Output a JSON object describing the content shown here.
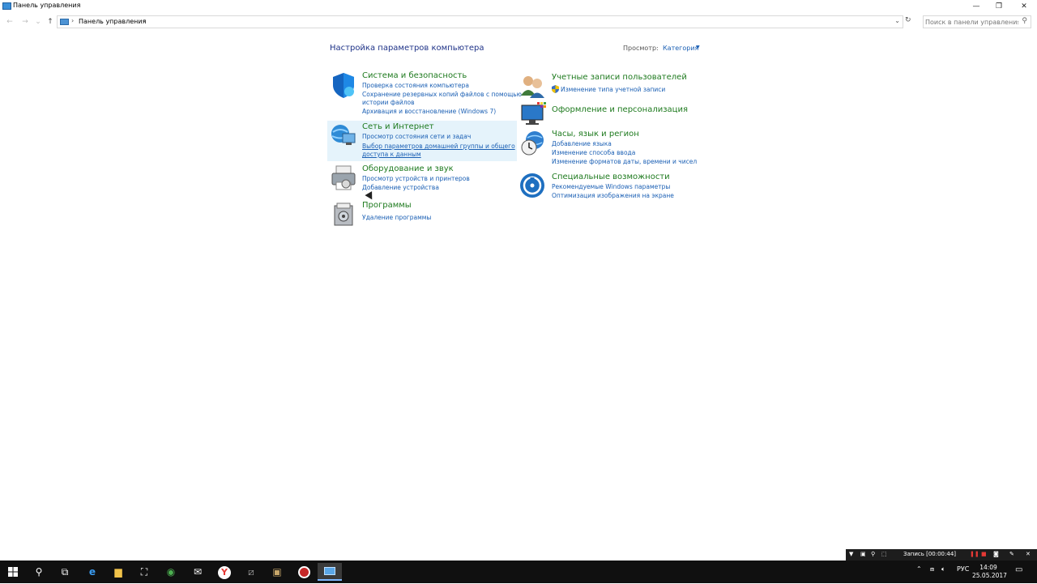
{
  "window": {
    "title": "Панель управления",
    "min": "—",
    "restore": "❐",
    "close": "✕"
  },
  "address": {
    "breadcrumb": "Панель управления",
    "sep1": "›",
    "sep2": "›",
    "dropdown": "⌄",
    "refresh": "↻",
    "back": "←",
    "forward": "→",
    "recent": "⌄",
    "up": "↑"
  },
  "search": {
    "placeholder": "Поиск в панели управления",
    "icon": "⚲"
  },
  "main": {
    "heading": "Настройка параметров компьютера",
    "view_label": "Просмотр:",
    "view_value": "Категория",
    "view_caret": "▼",
    "categories": [
      {
        "title": "Система и безопасность",
        "icon": "shield-icon",
        "links": [
          "Проверка состояния компьютера",
          "Сохранение резервных копий файлов с помощью",
          "истории файлов",
          "Архивация и восстановление (Windows 7)"
        ]
      },
      {
        "title": "Сеть и Интернет",
        "icon": "network-icon",
        "links": [
          "Просмотр состояния сети и задач",
          "Выбор параметров домашней группы и общего",
          "доступа к данным"
        ]
      },
      {
        "title": "Оборудование и звук",
        "icon": "printer-icon",
        "links": [
          "Просмотр устройств и принтеров",
          "Добавление устройства"
        ]
      },
      {
        "title": "Программы",
        "icon": "programs-icon",
        "links": [
          "Удаление программы"
        ]
      },
      {
        "title": "Учетные записи пользователей",
        "icon": "users-icon",
        "links": [
          "Изменение типа учетной записи"
        ]
      },
      {
        "title": "Оформление и персонализация",
        "icon": "personalization-icon",
        "links": []
      },
      {
        "title": "Часы, язык и регион",
        "icon": "clock-globe-icon",
        "links": [
          "Добавление языка",
          "Изменение способа ввода",
          "Изменение форматов даты, времени и чисел"
        ]
      },
      {
        "title": "Специальные возможности",
        "icon": "accessibility-icon",
        "links": [
          "Рекомендуемые Windows параметры",
          "Оптимизация изображения на экране"
        ]
      }
    ]
  },
  "recorder": {
    "label": "Запись [00:00:44]"
  },
  "taskbar": {
    "lang": "РУС",
    "time": "14:09",
    "date": "25.05.2017"
  },
  "colors": {
    "category_title": "#1e7a1e",
    "link": "#1a5fb4",
    "heading": "#1e3287",
    "hover_bg": "#e5f3fb",
    "taskbar": "#101010"
  }
}
